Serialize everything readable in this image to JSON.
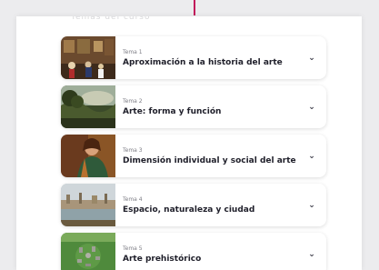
{
  "header": {
    "faded_title": "Temas del curso"
  },
  "topics": [
    {
      "tema": "Tema 1",
      "title": "Aproximación a la historia del arte",
      "thumbnail": "gallery-painting"
    },
    {
      "tema": "Tema 2",
      "title": "Arte: forma y función",
      "thumbnail": "landscape-painting"
    },
    {
      "tema": "Tema 3",
      "title": "Dimensión individual y social del arte",
      "thumbnail": "portrait-painting"
    },
    {
      "tema": "Tema 4",
      "title": "Espacio, naturaleza y ciudad",
      "thumbnail": "cityscape-painting"
    },
    {
      "tema": "Tema 5",
      "title": "Arte prehistórico",
      "thumbnail": "stonehenge-photo"
    }
  ],
  "icons": {
    "expand": "chevron-down-icon"
  },
  "colors": {
    "accent": "#c2185b",
    "text": "#1f1f2a",
    "muted": "#7d7d85"
  }
}
